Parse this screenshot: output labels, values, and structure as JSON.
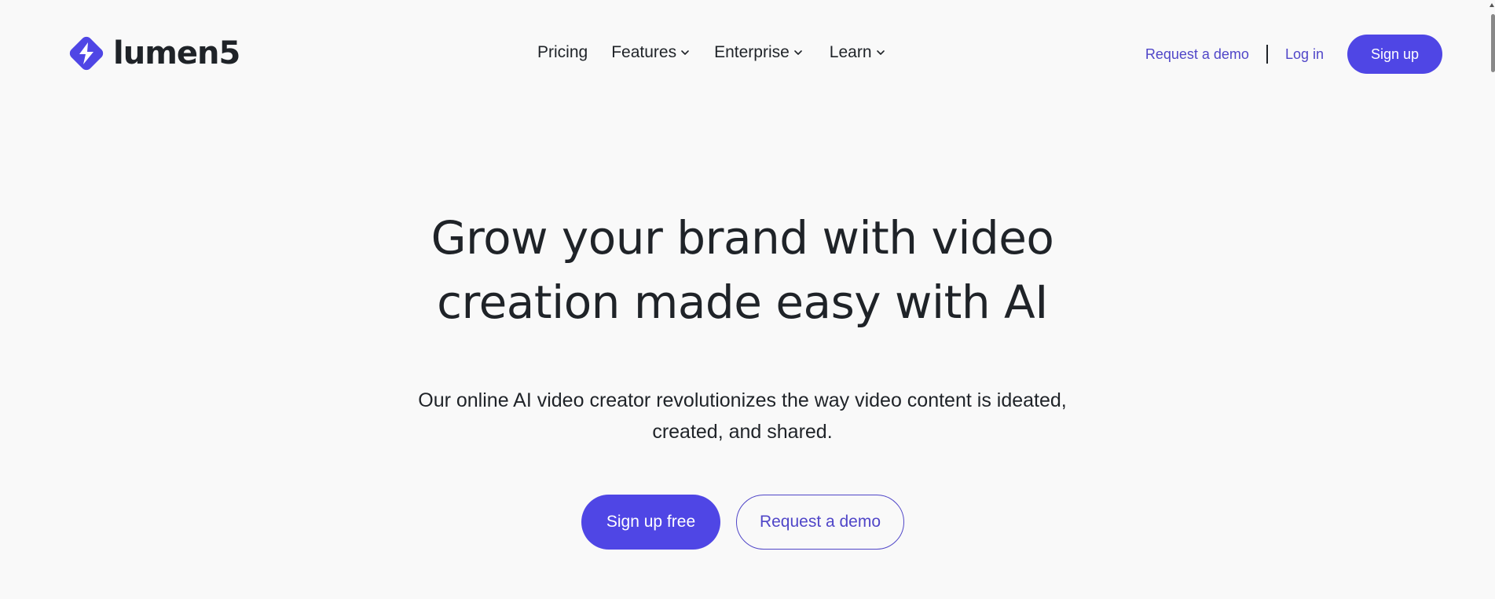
{
  "brand": {
    "name": "lumen5",
    "accent": "#4f46e5",
    "link_color": "#5046c8"
  },
  "nav": {
    "items": [
      {
        "label": "Pricing",
        "has_dropdown": false
      },
      {
        "label": "Features",
        "has_dropdown": true
      },
      {
        "label": "Enterprise",
        "has_dropdown": true
      },
      {
        "label": "Learn",
        "has_dropdown": true
      }
    ],
    "request_demo": "Request a demo",
    "log_in": "Log in",
    "sign_up": "Sign up"
  },
  "hero": {
    "title_line1": "Grow your brand with video",
    "title_line2": "creation made easy with AI",
    "subtitle_line1": "Our online AI video creator revolutionizes the way video content is ideated,",
    "subtitle_line2": "created, and shared.",
    "primary_cta": "Sign up free",
    "secondary_cta": "Request a demo"
  },
  "icons": {
    "logo": "lumen5-logo-icon",
    "dropdown": "chevron-down-icon"
  }
}
